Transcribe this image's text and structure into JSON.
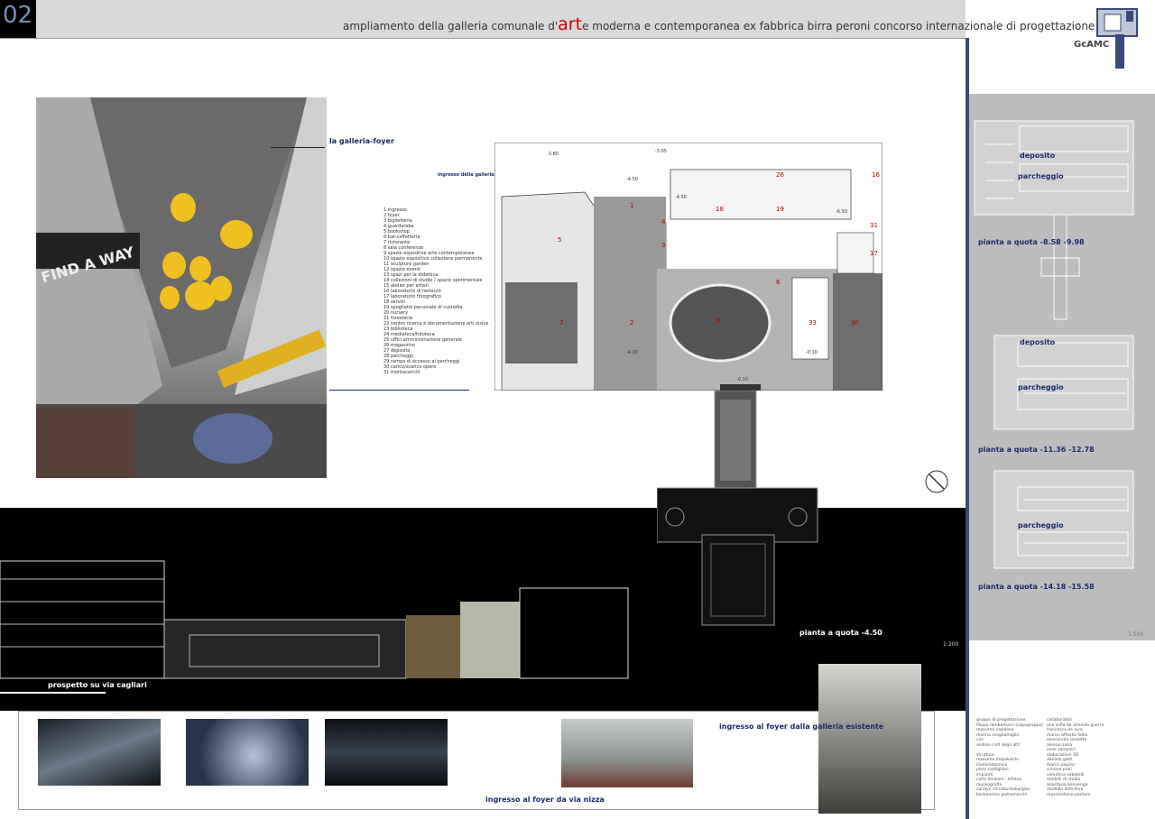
{
  "header": {
    "sheet_number": "02",
    "title_before": "ampliamento della galleria comunale d'",
    "title_highlight": "art",
    "title_after": "e moderna e contemporanea ex fabbrica birra peroni  concorso internazionale di progettazione",
    "logo_text": "GcAMC"
  },
  "labels": {
    "foyer": "la galleria-foyer",
    "entrance": "ingresso della galleria",
    "plan_level": "pianta a quota -4.50",
    "elevation": "prospetto su via cagliari",
    "scale_main": "1:200",
    "scale_right": "1:500",
    "foyer_existing": "ingresso al foyer dalla galleria esistente",
    "foyer_nizza": "ingresso al foyer da via nizza"
  },
  "legend": [
    "1 ingresso",
    "2 foyer",
    "3 biglietteria",
    "4 guardaroba",
    "5 bookshop",
    "6 bar-caffetteria",
    "7 ristorante",
    "8 sala conferenze",
    "9 spazio espositivo arte contemporanea",
    "10 spazio espositivo collezione permanente",
    "11 sculpture garden",
    "12 spazio eventi",
    "13 spazi per la didattica",
    "14 collezioni di studio / spazio sperimentale",
    "15 atelier per artisti",
    "16 laboratorio di restauro",
    "17 laboratorio fotografico",
    "18 servizi",
    "19 spogliatoi personale di custodia",
    "20 nursery",
    "21 foresteria",
    "22 centro ricerca e documentazione arti visive",
    "23 biblioteca",
    "24 mediateca/fototeca",
    "25 uffici amministrazione generale",
    "26 magazzino",
    "27 deposito",
    "28 parcheggi",
    "29 rampa di accesso ai parcheggi",
    "30 carico/scarico opere",
    "31 montacarichi"
  ],
  "plan_levels": [
    "-3.80",
    "-3.05",
    "-4.50",
    "-4.20",
    "-4.50",
    "-0.10",
    "-6.93",
    "-0.10"
  ],
  "plan_rooms": [
    "1",
    "2",
    "3",
    "4",
    "5",
    "6",
    "7",
    "8",
    "16",
    "17",
    "18",
    "19",
    "26",
    "31",
    "33",
    "30"
  ],
  "right_panels": [
    {
      "deposit": "deposito",
      "parking": "parcheggio",
      "level": "pianta a quota  -8.58  -9.98"
    },
    {
      "deposit": "deposito",
      "parking": "parcheggio",
      "level": "pianta a quota  -11.36  -12.78"
    },
    {
      "deposit": "",
      "parking": "parcheggio",
      "level": "pianta a quota  -14.18  -15.58"
    }
  ],
  "photo_text": "FIND A WAY",
  "credits_left": [
    "gruppo di progettazione",
    "filippo lambertucci (capogruppo)",
    "massimo casolone",
    "marina scognamiglio",
    "con",
    "andrea ciofi degli atti",
    "",
    "strutture",
    "massimo majowiecki",
    "illuminotecnica",
    "piero castiglioni",
    "impianti",
    "carlo fenzioni - alfatau",
    "museografia",
    "carolyn christov-bakargiev",
    "bartolomeo pietromarchi"
  ],
  "credits_right": [
    "collaboratori",
    "ana sofia de almeida guerra",
    "francesca de luca",
    "maria raffaella fallio",
    "alessandro lanzetta",
    "alessio salza",
    "ioele zampieri",
    "elaborazioni 3D",
    "daniele gatti",
    "marco pepino",
    "simone proli",
    "valentina sabatelli",
    "modelli di studio",
    "anastasia benvenga",
    "modello definitivo",
    "massimiliano pantani"
  ],
  "colors": {
    "accent": "#c00000",
    "navy": "#1d2a6a",
    "bar": "#3a4a7a"
  }
}
